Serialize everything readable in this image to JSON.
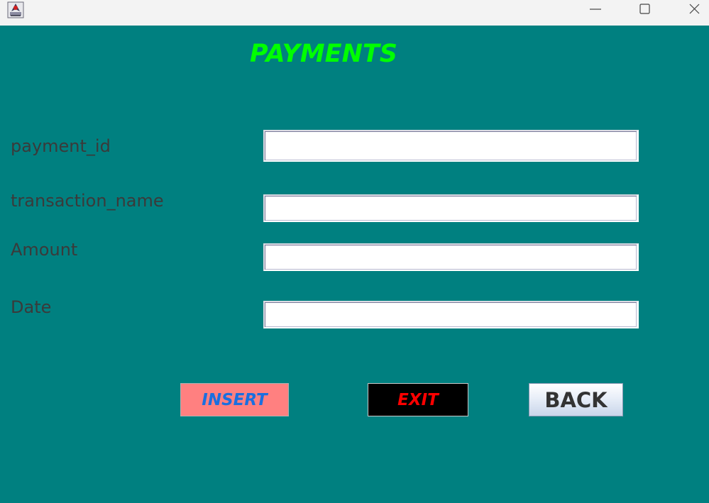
{
  "window": {
    "icon": "java-app-icon",
    "controls": {
      "minimize": "minimize-icon",
      "maximize": "maximize-icon",
      "close": "close-icon"
    }
  },
  "form": {
    "title": "PAYMENTS",
    "fields": [
      {
        "label": "payment_id",
        "value": ""
      },
      {
        "label": "transaction_name",
        "value": ""
      },
      {
        "label": "Amount",
        "value": ""
      },
      {
        "label": "Date",
        "value": ""
      }
    ],
    "buttons": {
      "insert": "INSERT",
      "exit": "EXIT",
      "back": "BACK"
    }
  },
  "colors": {
    "background": "#008080",
    "title": "#00ff00",
    "insert_bg": "#ff8080",
    "insert_text": "#1a6fe0",
    "exit_bg": "#000000",
    "exit_text": "#ff0000"
  }
}
